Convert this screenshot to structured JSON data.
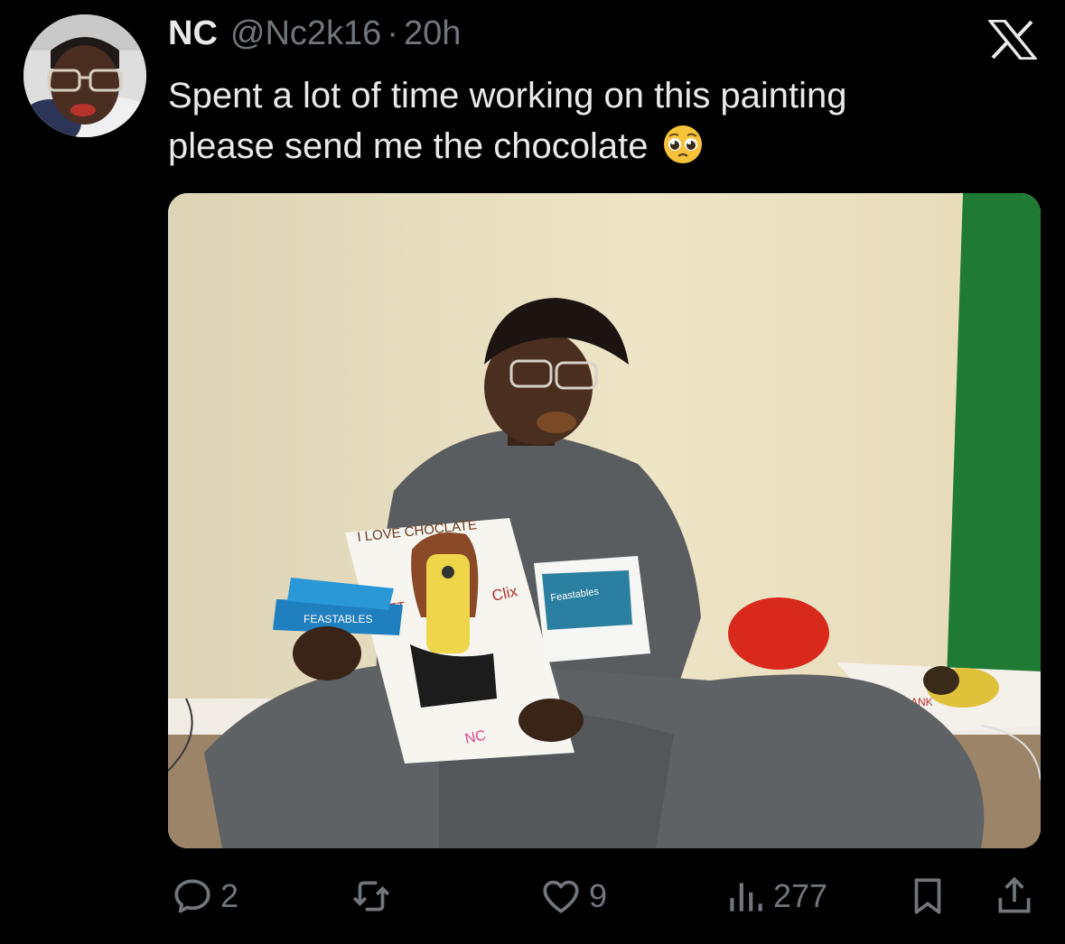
{
  "tweet": {
    "author_name": "NC",
    "author_handle": "@Nc2k16",
    "separator": "·",
    "time_ago": "20h",
    "text_line1": "Spent a lot of time working on this painting",
    "text_line2": "please send me the chocolate",
    "emoji": "pleading-face",
    "media": {
      "painting_texts": [
        "I LOVE CHOCLATE",
        "FEASTABLES",
        "SET",
        "Clix",
        "NC",
        "FRANK"
      ],
      "poster_text": "Feastables"
    },
    "actions": {
      "replies": "2",
      "reposts": "",
      "likes": "9",
      "views": "277"
    }
  },
  "icons": [
    "x-logo-icon",
    "reply-icon",
    "repost-icon",
    "like-icon",
    "views-icon",
    "bookmark-icon",
    "share-icon"
  ],
  "colors": {
    "background": "#000000",
    "text": "#e7e9ea",
    "muted": "#71767b"
  }
}
